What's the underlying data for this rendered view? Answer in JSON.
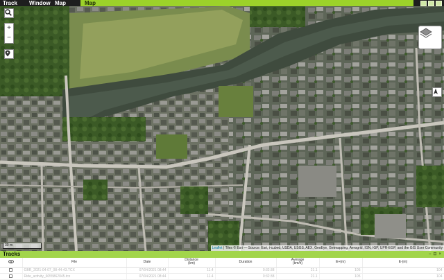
{
  "menu": {
    "track": "Track",
    "window": "Window",
    "map": "Map"
  },
  "map_tab": {
    "label": "Map"
  },
  "map": {
    "zoom_in": "+",
    "zoom_out": "−",
    "scale_label": "30 m",
    "attribution_leaflet": "Leaflet",
    "attribution_text": " | Tiles © Esri — Source: Esri, i-cubed, USDA, USGS, AEX, GeoEye, Getmapping, Aerogrid, IGN, IGP, UPR-EGP, and the GIS User Community"
  },
  "tracks": {
    "title": "Tracks",
    "panel_controls": [
      "−",
      "⊡",
      "×"
    ],
    "columns": {
      "file": "File",
      "date": "Date",
      "distance": "Distance",
      "distance_unit": "(km)",
      "duration": "Duration",
      "average": "Average",
      "average_unit": "(km/h)",
      "e_plus": "E+(m)",
      "e_minus": "E-(m)"
    },
    "rows": [
      {
        "file": "GBR_2021-04-07_08-44-43.TCX",
        "date": "07/04/2021 08:44",
        "distance": "11.4",
        "duration": "0:32:38",
        "average": "21.1",
        "e_plus": "105",
        "e_minus": "104"
      },
      {
        "file": "Ride_activity_6055862045.tcx",
        "date": "07/04/2021 08:44",
        "distance": "11.4",
        "duration": "0:32:38",
        "average": "21.1",
        "e_plus": "105",
        "e_minus": "104"
      }
    ]
  },
  "colors": {
    "accent": "#9cd22a",
    "menubar": "#1e1e1e"
  },
  "icons": {
    "search": "search-icon",
    "zoom_in": "plus-icon",
    "zoom_out": "minus-icon",
    "pin": "map-pin-icon",
    "layers": "layers-icon",
    "compass": "compass-icon",
    "eye": "eye-icon"
  }
}
